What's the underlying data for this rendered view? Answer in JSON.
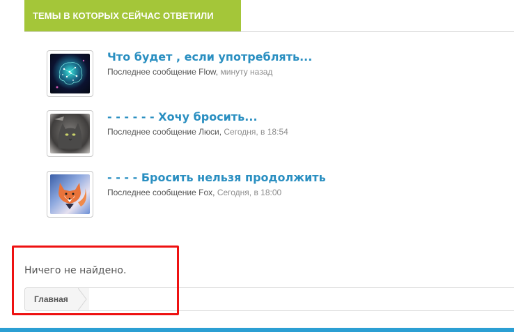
{
  "section": {
    "title": "ТЕМЫ В КОТОРЫХ СЕЙЧАС ОТВЕТИЛИ"
  },
  "threads": [
    {
      "title": "Что будет , если употреблять...",
      "meta_prefix": "Последнее сообщение Flow,",
      "time": "минуту назад",
      "avatar_icon": "neural-brain-avatar"
    },
    {
      "title": "- - - - - - Хочу бросить...",
      "meta_prefix": "Последнее сообщение Люси,",
      "time": "Сегодня, в 18:54",
      "avatar_icon": "cat-avatar"
    },
    {
      "title": "- - - - Бросить нельзя продолжить",
      "meta_prefix": "Последнее сообщение Fox,",
      "time": "Сегодня, в 18:00",
      "avatar_icon": "fox-avatar"
    }
  ],
  "empty_message": "Ничего не найдено.",
  "breadcrumb": {
    "home_label": "Главная"
  },
  "colors": {
    "header_bg": "#a4c639",
    "link": "#2a8fc1",
    "highlight": "#ee1111",
    "footer_bar": "#2b9fd3"
  }
}
